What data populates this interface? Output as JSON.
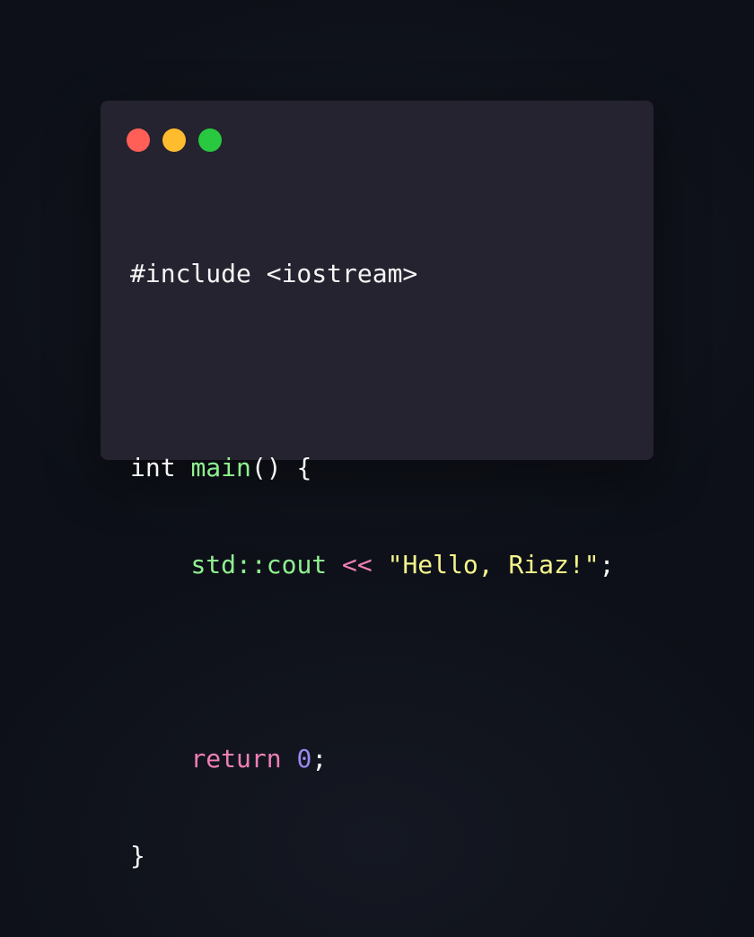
{
  "colors": {
    "background": "#0d1018",
    "window": "#25232f",
    "text": "#f5f5f5",
    "function": "#8ff08f",
    "keyword": "#ef7fb6",
    "string": "#f4f48c",
    "number": "#9c87f0"
  },
  "window_controls": [
    {
      "name": "close",
      "color": "#ff5f57"
    },
    {
      "name": "minimize",
      "color": "#febc2e"
    },
    {
      "name": "maximize",
      "color": "#28c840"
    }
  ],
  "code": {
    "line1": "#include <iostream>",
    "line3_type": "int",
    "line3_space": " ",
    "line3_func": "main",
    "line3_rest": "() {",
    "line4_indent": "    ",
    "line4_stream": "std::cout",
    "line4_space1": " ",
    "line4_op": "<<",
    "line4_space2": " ",
    "line4_string": "\"Hello, Riaz!\"",
    "line4_semi": ";",
    "line6_indent": "    ",
    "line6_keyword": "return",
    "line6_space": " ",
    "line6_number": "0",
    "line6_semi": ";",
    "line7": "}"
  }
}
